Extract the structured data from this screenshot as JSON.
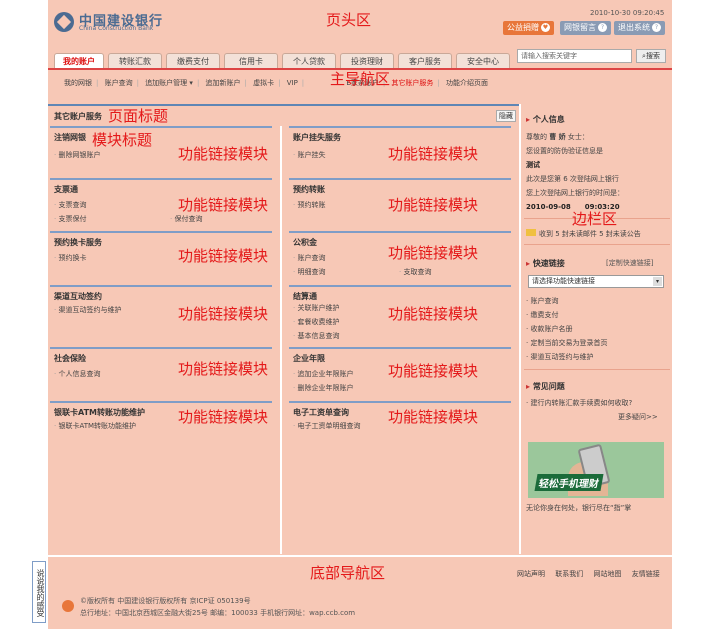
{
  "header": {
    "logo_cn": "中国建设银行",
    "logo_en": "China Construction Bank",
    "datetime": "2010-10-30 09:20:45",
    "btn_gongyi": "公益捐赠",
    "btn_wangyin": "网银留言",
    "btn_exit": "退出系统"
  },
  "nav": {
    "tabs": [
      "我的账户",
      "转账汇款",
      "缴费支付",
      "信用卡",
      "个人贷款",
      "投资理财",
      "客户服务",
      "安全中心"
    ],
    "search_placeholder": "请输入搜索关键字",
    "search_btn": "搜索",
    "subnav": [
      "我的网银",
      "账户查询",
      "追加账户管理 ▾",
      "追加新账户",
      "虚拟卡",
      "VIP",
      "E家亲账户",
      "其它账户服务",
      "功能介绍页面"
    ]
  },
  "annotations": {
    "header": "页头区",
    "main_nav": "主导航区",
    "page_title": "页面标题",
    "module_title": "模块标题",
    "func_module": "功能链接模块",
    "sidebar": "边栏区",
    "footer_nav": "底部导航区"
  },
  "page_title": "其它账户服务",
  "hide_btn": "隐藏",
  "modules": [
    {
      "title": "注销网银",
      "links": [
        "删除网银账户"
      ]
    },
    {
      "title": "账户挂失服务",
      "links": [
        "账户挂失"
      ]
    },
    {
      "title": "支票通",
      "links": [
        "支票查询",
        "支票保付",
        "保付查询"
      ]
    },
    {
      "title": "预约转账",
      "links": [
        "预约转账"
      ]
    },
    {
      "title": "预约换卡服务",
      "links": [
        "预约换卡"
      ]
    },
    {
      "title": "公积金",
      "links": [
        "账户查询",
        "明细查询",
        "支取查询"
      ]
    },
    {
      "title": "渠道互动签约",
      "links": [
        "渠道互动签约与维护"
      ]
    },
    {
      "title": "结算通",
      "links": [
        "关联账户维护",
        "套餐收费维护",
        "基本信息查询"
      ]
    },
    {
      "title": "社会保险",
      "links": [
        "个人信息查询"
      ]
    },
    {
      "title": "企业年限",
      "links": [
        "追加企业年限账户",
        "删除企业年限账户"
      ]
    },
    {
      "title": "银联卡ATM转账功能维护",
      "links": [
        "银联卡ATM转账功能维护"
      ]
    },
    {
      "title": "电子工资单查询",
      "links": [
        "电子工资单明细查询"
      ]
    }
  ],
  "sidebar": {
    "personal_title": "个人信息",
    "greeting_prefix": "尊敬的",
    "user_name": "曹 娇",
    "greeting_suffix": "女士：",
    "verify_text": "您设置的防伪验证信息是",
    "verify_value": "测试",
    "login_count_text": "此次是您第 6 次登陆网上银行",
    "last_login_text": "您上次登陆网上银行的时间是：",
    "last_login_time": "2010-09-08　　09:03:20",
    "mail_text": "收到 5 封未读邮件 5 封未读公告",
    "quick_title": "快速链接",
    "quick_custom": "[定制快速链接]",
    "quick_select": "请选择功能快速链接",
    "quick_links": [
      "账户查询",
      "缴费支付",
      "收款账户名册",
      "定制当前交易为登录首页",
      "渠道互动签约与维护"
    ],
    "faq_title": "常见问题",
    "faq_item": "建行内转账汇款手续费如何收取?",
    "faq_more": "更多疑问>>",
    "banner_text": "轻松手机理财",
    "slogan": "无论你身在何处，银行尽在“指”掌"
  },
  "footer": {
    "links": [
      "网站声明",
      "联系我们",
      "网站地图",
      "友情链接"
    ],
    "copyright": "©版权所有 中国建设银行版权所有 京ICP证 050139号",
    "address": "总行地址：中国北京西城区金融大街25号 邮编：100033 手机银行网址：wap.ccb.com",
    "feedback": "说说我的感受"
  }
}
